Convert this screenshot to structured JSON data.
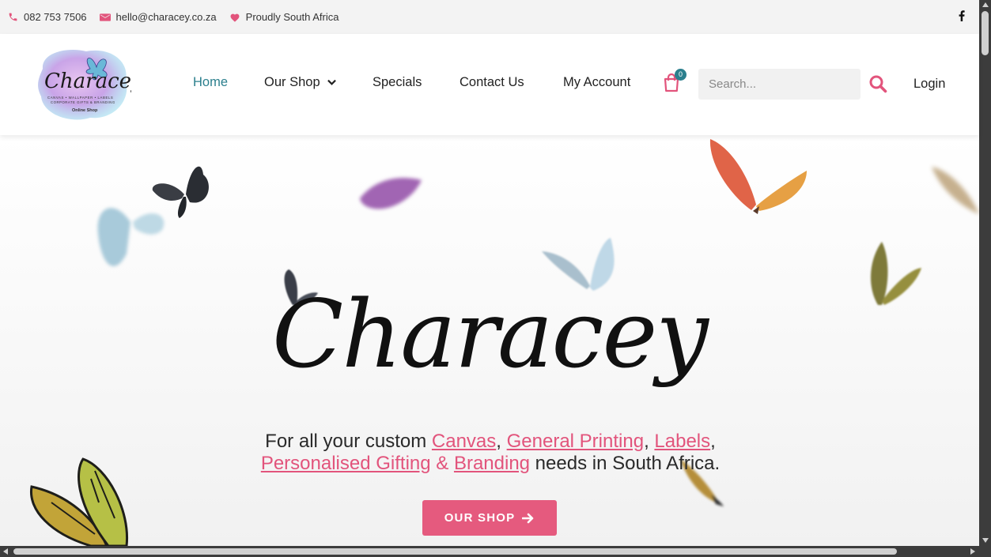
{
  "topbar": {
    "phone": "082 753 7506",
    "email": "hello@characey.co.za",
    "tagline": "Proudly South Africa",
    "social_icon": "facebook-icon"
  },
  "header": {
    "logo_alt": "Characey",
    "nav": [
      {
        "label": "Home",
        "active": true
      },
      {
        "label": "Our Shop",
        "dropdown": true
      },
      {
        "label": "Specials"
      },
      {
        "label": "Contact Us"
      },
      {
        "label": "My Account"
      }
    ],
    "cart_count": "0",
    "search_placeholder": "Search...",
    "login_label": "Login"
  },
  "hero": {
    "title": "Characey",
    "text_1": "For all your custom ",
    "link_canvas": "Canvas",
    "sep_1": ", ",
    "link_printing": "General Printing",
    "sep_2": ", ",
    "link_labels": "Labels",
    "sep_3": ",",
    "link_gifting": "Personalised Gifting",
    "amp": " & ",
    "link_branding": "Branding",
    "text_2": " needs in South Africa.",
    "button_label": "OUR SHOP"
  },
  "colors": {
    "accent_pink": "#e55a7e",
    "accent_teal": "#2b7f8d",
    "topbar_bg": "#f3f3f3"
  }
}
